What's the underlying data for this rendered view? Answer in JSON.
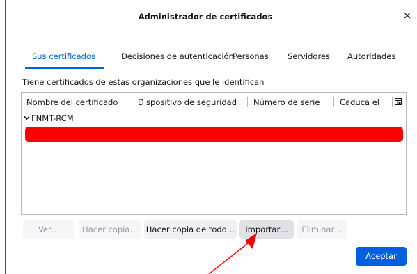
{
  "dialog": {
    "title": "Administrador de certificados",
    "close_glyph": "×"
  },
  "tabs": [
    {
      "label": "Sus certificados",
      "selected": true
    },
    {
      "label": "Decisiones de autenticación",
      "selected": false
    },
    {
      "label": "Personas",
      "selected": false
    },
    {
      "label": "Servidores",
      "selected": false
    },
    {
      "label": "Autoridades",
      "selected": false
    }
  ],
  "description": "Tiene certificados de estas organizaciones que le identifican",
  "table": {
    "columns": [
      "Nombre del certificado",
      "Dispositivo de seguridad",
      "Número de serie",
      "Caduca el"
    ],
    "column_picker_icon": "column-picker-icon",
    "groups": [
      {
        "name": "FNMT-RCM",
        "expanded": true,
        "chevron_glyph": "❯",
        "redacted_rows": 1
      }
    ]
  },
  "buttons": {
    "ver": {
      "label": "Ver…",
      "enabled": false
    },
    "hacer_copia": {
      "label": "Hacer copia…",
      "enabled": false
    },
    "hacer_copia_todo": {
      "label": "Hacer copia de todo…",
      "enabled": true
    },
    "importar": {
      "label": "Importar…",
      "enabled": true
    },
    "eliminar": {
      "label": "Eliminar…",
      "enabled": false
    },
    "aceptar": {
      "label": "Aceptar",
      "enabled": true
    }
  },
  "colors": {
    "accent": "#0061e0",
    "redaction": "#ff0000",
    "annotation_arrow": "#ff0000"
  }
}
